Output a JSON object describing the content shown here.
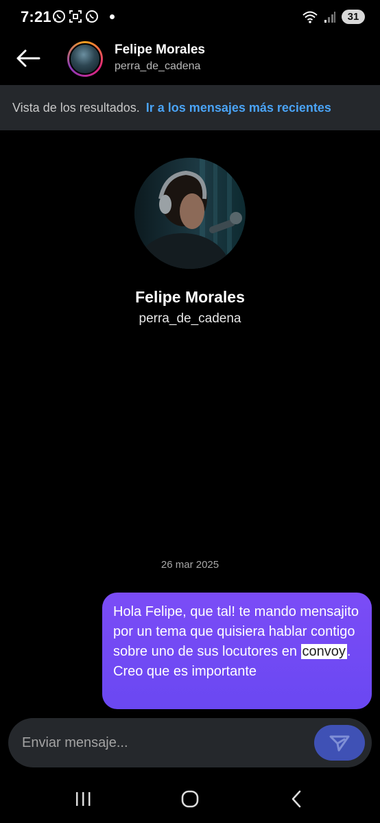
{
  "status_bar": {
    "time": "7:21",
    "battery": "31",
    "icons": [
      "whatsapp-icon",
      "screenshot-icon",
      "whatsapp-icon",
      "wifi-icon",
      "signal-icon"
    ]
  },
  "header": {
    "name": "Felipe Morales",
    "username": "perra_de_cadena"
  },
  "results_banner": {
    "text": "Vista de los resultados.",
    "link": "Ir a los mensajes más recientes",
    "link_color": "#4aa3f5"
  },
  "profile": {
    "name": "Felipe Morales",
    "username": "perra_de_cadena"
  },
  "conversation": {
    "date": "26 mar 2025",
    "message": {
      "before": "Hola Felipe, que tal! te mando mensajito por un tema que quisiera hablar contigo sobre uno de sus locutores en ",
      "highlight": "convoy",
      "after": ". Creo que es importante",
      "bubble_color": "#6f4af4"
    }
  },
  "composer": {
    "placeholder": "Enviar mensaje..."
  },
  "nav_bar": {
    "items": [
      "recents-icon",
      "home-icon",
      "back-icon"
    ]
  }
}
